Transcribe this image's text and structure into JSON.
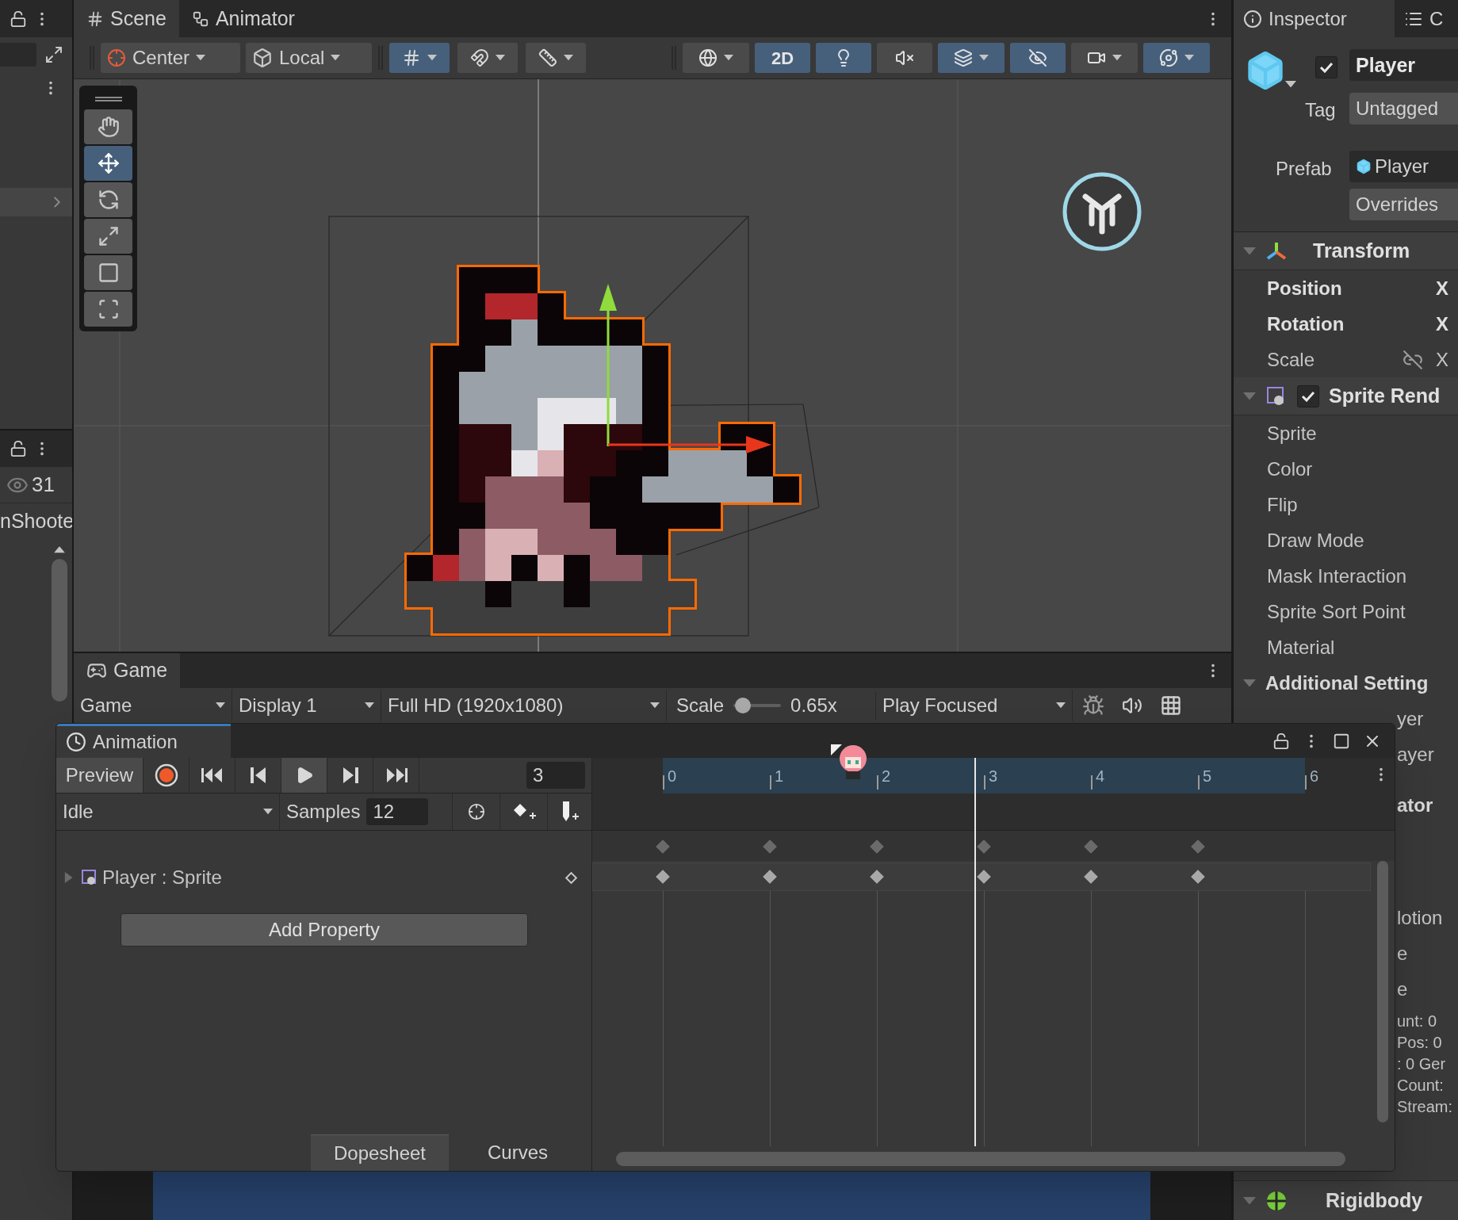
{
  "hierarchy_panel": {
    "count": "31",
    "item": "nShoote"
  },
  "scene": {
    "tabs": [
      {
        "label": "Scene",
        "kind": "scene",
        "selected": true
      },
      {
        "label": "Animator",
        "kind": "animator",
        "selected": false
      }
    ],
    "pivot": "Center",
    "space": "Local",
    "snap_toggles": [
      {
        "kind": "grid",
        "on": true
      },
      {
        "kind": "increment",
        "on": false
      },
      {
        "kind": "ruler",
        "on": false
      }
    ],
    "view_toggles": [
      {
        "kind": "shading",
        "on": false
      },
      {
        "kind": "flat",
        "label": "2D",
        "on": true
      },
      {
        "kind": "lighting",
        "on": true
      },
      {
        "kind": "audio",
        "on": false
      },
      {
        "kind": "effects",
        "on": true
      },
      {
        "kind": "visibility",
        "on": true
      },
      {
        "kind": "camera",
        "on": false
      },
      {
        "kind": "gizmos",
        "on": true
      }
    ],
    "tools": [
      {
        "kind": "hand",
        "selected": false
      },
      {
        "kind": "move",
        "selected": true
      },
      {
        "kind": "rotate",
        "selected": false
      },
      {
        "kind": "scale",
        "selected": false
      },
      {
        "kind": "rect",
        "selected": false
      },
      {
        "kind": "transform",
        "selected": false
      }
    ]
  },
  "game": {
    "tab": "Game",
    "view": "Game",
    "display": "Display 1",
    "resolution": "Full HD (1920x1080)",
    "scale_label": "Scale",
    "scale": {
      "level": 0.05
    },
    "scale_reading": "0.65x",
    "play_mode": "Play Focused"
  },
  "animation": {
    "title": "Animation",
    "preview": "Preview",
    "frame": "3",
    "clip": "Idle",
    "samples_label": "Samples",
    "samples": "12",
    "ruler": [
      {
        "label": "0",
        "keyframe": true
      },
      {
        "label": "1",
        "keyframe": true
      },
      {
        "label": "2",
        "keyframe": true
      },
      {
        "label": "3",
        "keyframe": true
      },
      {
        "label": "4",
        "keyframe": true
      },
      {
        "label": "5",
        "keyframe": true
      },
      {
        "label": "6",
        "keyframe": false
      }
    ],
    "playhead": {
      "level": 0.485
    },
    "tracks": [
      {
        "label": "Player : Sprite",
        "expanded": false
      }
    ],
    "add_property": "Add Property",
    "views": [
      {
        "label": "Dopesheet",
        "selected": true
      },
      {
        "label": "Curves",
        "selected": false
      }
    ]
  },
  "inspector": {
    "tabs": [
      {
        "label": "Inspector",
        "kind": "inspector",
        "selected": true
      },
      {
        "label": "C",
        "kind": "console",
        "selected": false
      }
    ],
    "object": {
      "active": true,
      "name": "Player",
      "tag_label": "Tag",
      "tag": "Untagged",
      "prefab_label": "Prefab",
      "prefab": "Player",
      "overrides": "Overrides"
    },
    "components": [
      {
        "kind": "transform",
        "title": "Transform",
        "expanded": true,
        "rows": [
          {
            "label": "Position",
            "overridden": true,
            "axis": "X",
            "kind": "vector"
          },
          {
            "label": "Rotation",
            "overridden": true,
            "axis": "X",
            "kind": "vector"
          },
          {
            "label": "Scale",
            "overridden": false,
            "axis": "X",
            "linked": false,
            "kind": "scale"
          }
        ]
      },
      {
        "kind": "sprite_renderer",
        "title": "Sprite Rend",
        "enabled": true,
        "expanded": true,
        "rows": [
          {
            "label": "Sprite",
            "overridden": false
          },
          {
            "label": "Color",
            "overridden": false
          },
          {
            "label": "Flip",
            "overridden": false
          },
          {
            "label": "Draw Mode",
            "overridden": false
          },
          {
            "label": "Mask Interaction",
            "overridden": false
          },
          {
            "label": "Sprite Sort Point",
            "overridden": false
          },
          {
            "label": "Material",
            "overridden": false
          }
        ],
        "section": {
          "title": "Additional Setting",
          "expanded": true
        }
      }
    ],
    "covered_rows": [
      {
        "kind": "row",
        "text": "yer"
      },
      {
        "kind": "row",
        "text": "ayer"
      },
      {
        "kind": "header",
        "text": "ator"
      },
      {
        "kind": "row",
        "text": "lotion"
      },
      {
        "kind": "row",
        "text": "e"
      },
      {
        "kind": "row",
        "text": "e"
      },
      {
        "kind": "stat",
        "text": "unt: 0"
      },
      {
        "kind": "stat",
        "text": "Pos: 0"
      },
      {
        "kind": "stat",
        "text": ": 0 Ger"
      },
      {
        "kind": "stat",
        "text": "Count:"
      },
      {
        "kind": "stat",
        "text": "Stream:"
      }
    ],
    "next_component": {
      "title": "Rigidbody",
      "expanded": true
    }
  }
}
